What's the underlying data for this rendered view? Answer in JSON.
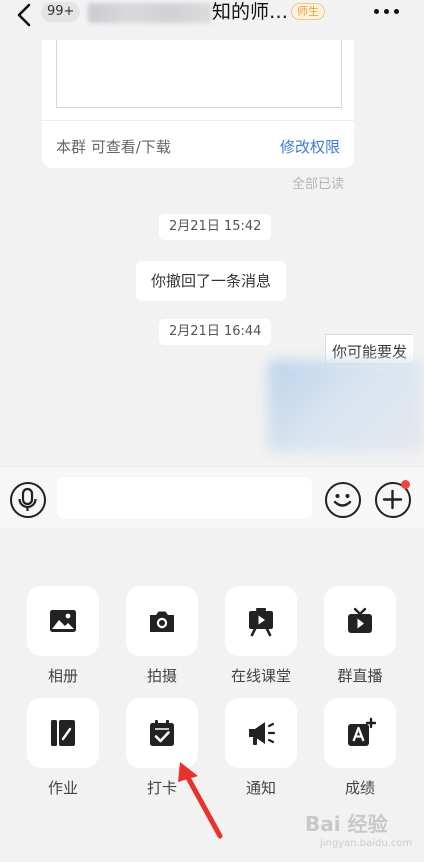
{
  "header": {
    "unread_count": "99+",
    "title": "知的师…",
    "role_badge": "师生"
  },
  "file_card": {
    "permission_text": "本群 可查看/下载",
    "edit_permission_label": "修改权限"
  },
  "messages": {
    "all_read": "全部已读",
    "time_1": "2月21日 15:42",
    "system_message": "你撤回了一条消息",
    "time_2": "2月21日 16:44",
    "suggestion_tip": "你可能要发"
  },
  "input": {
    "placeholder": ""
  },
  "tools": [
    {
      "label": "相册",
      "icon": "photo-album-icon"
    },
    {
      "label": "拍摄",
      "icon": "camera-icon"
    },
    {
      "label": "在线课堂",
      "icon": "online-class-icon"
    },
    {
      "label": "群直播",
      "icon": "group-live-icon"
    },
    {
      "label": "作业",
      "icon": "homework-icon"
    },
    {
      "label": "打卡",
      "icon": "check-in-icon"
    },
    {
      "label": "通知",
      "icon": "announcement-icon"
    },
    {
      "label": "成绩",
      "icon": "grades-icon"
    }
  ],
  "watermark": {
    "text": "Bai 经验",
    "subtext": "jingyan.baidu.com"
  },
  "colors": {
    "accent_link": "#3b7be0",
    "badge_orange": "#e6a23c",
    "notification_red": "#f0453a",
    "annotation_arrow": "#e8322c"
  }
}
